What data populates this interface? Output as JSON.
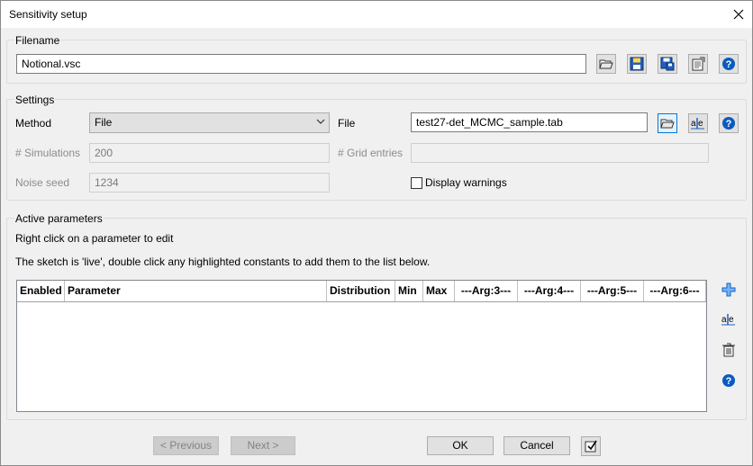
{
  "window": {
    "title": "Sensitivity setup"
  },
  "filename_group": {
    "label": "Filename",
    "value": "Notional.vsc"
  },
  "settings": {
    "label": "Settings",
    "method_label": "Method",
    "method_value": "File",
    "file_label": "File",
    "file_value": "test27-det_MCMC_sample.tab",
    "simulations_label": "# Simulations",
    "simulations_value": "200",
    "grid_entries_label": "# Grid entries",
    "grid_entries_value": "",
    "noise_seed_label": "Noise seed",
    "noise_seed_value": "1234",
    "display_warnings_label": "Display warnings",
    "display_warnings_checked": false
  },
  "active_parameters": {
    "label": "Active parameters",
    "hint1": "Right click on a parameter to edit",
    "hint2": "The sketch is 'live', double click any highlighted constants to add them to the list below.",
    "columns": [
      "Enabled",
      "Parameter",
      "Distribution",
      "Min",
      "Max",
      "---Arg:3---",
      "---Arg:4---",
      "---Arg:5---",
      "---Arg:6---"
    ],
    "rows": []
  },
  "footer": {
    "previous_label": "< Previous",
    "next_label": "Next >",
    "ok_label": "OK",
    "cancel_label": "Cancel"
  },
  "colors": {
    "help_blue": "#0a5bbf",
    "accent": "#0078d7"
  }
}
